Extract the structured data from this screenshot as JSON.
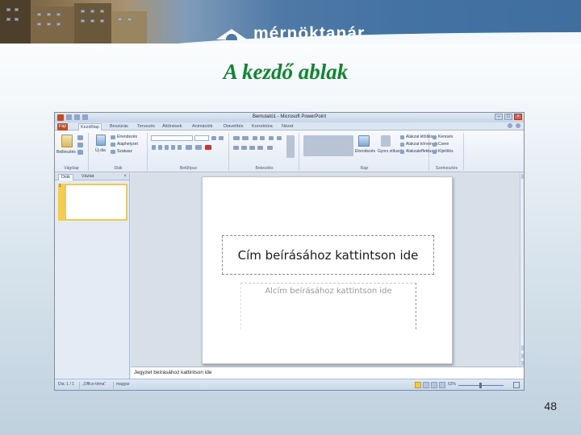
{
  "banner": {
    "logo_text": "mérnöktanár"
  },
  "slide": {
    "title": "A kezdő ablak",
    "page_number": "48"
  },
  "ppt": {
    "window_title": "Bemutató1 - Microsoft PowerPoint",
    "tabs": [
      "Fájl",
      "Kezdőlap",
      "Beszúrás",
      "Tervezés",
      "Áttűnések",
      "Animációk",
      "Diavetítés",
      "Korrektúra",
      "Nézet"
    ],
    "ribbon": {
      "groups": [
        "Vágólap",
        "Diák",
        "Betűtípus",
        "Bekezdés",
        "Rajz",
        "Szerkesztés"
      ],
      "clipboard": {
        "paste": "Beillesztés"
      },
      "slides": {
        "new_slide": "Új dia",
        "layout": "Elrendezés",
        "reset": "Alaphelyzet",
        "section": "Szakasz"
      },
      "drawing": {
        "arrange": "Elrendezés",
        "quick_styles": "Gyors stílusok",
        "fill": "Alakzat kitöltése",
        "outline": "Alakzat körvonala",
        "effects": "Alakzateffektusok"
      },
      "editing": {
        "find": "Keresés",
        "replace": "Csere",
        "select": "Kijelölés"
      }
    },
    "panel": {
      "tabs": [
        "Diák",
        "Vázlat"
      ],
      "close": "×",
      "thumb_number": "1"
    },
    "placeholders": {
      "title": "Cím beírásához kattintson ide",
      "subtitle": "Alcím beírásához kattintson ide",
      "notes": "Jegyzet beírásához kattintson ide"
    },
    "status": {
      "slide": "Dia: 1 / 1",
      "theme": "„Office-téma”",
      "language": "magyar",
      "zoom": "63%"
    }
  }
}
